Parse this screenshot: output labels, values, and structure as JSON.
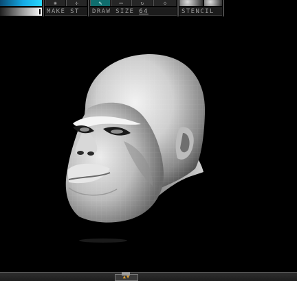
{
  "toolbar": {
    "make_stroke_label": "MAKE ST",
    "draw_size_label": "DRAW SIZE",
    "draw_size_value": "64",
    "stencil_label": "STENCIL"
  },
  "colors": {
    "accent_teal": "#0f6d6d",
    "color_swatch_blue": "#14a9e4",
    "tray_arrow": "#e0a030"
  },
  "icons": {
    "tool_1": "brush-icon",
    "tool_2": "move-icon",
    "tool_3": "draw-icon",
    "tool_4": "edit-icon",
    "tool_5": "rotate-icon",
    "tool_6": "diamond-icon",
    "stencil": "stencil-sphere-icon"
  },
  "viewport": {
    "model": "sculpted-head-mesh"
  },
  "bottom": {
    "tray_arrows": "▲▼"
  }
}
